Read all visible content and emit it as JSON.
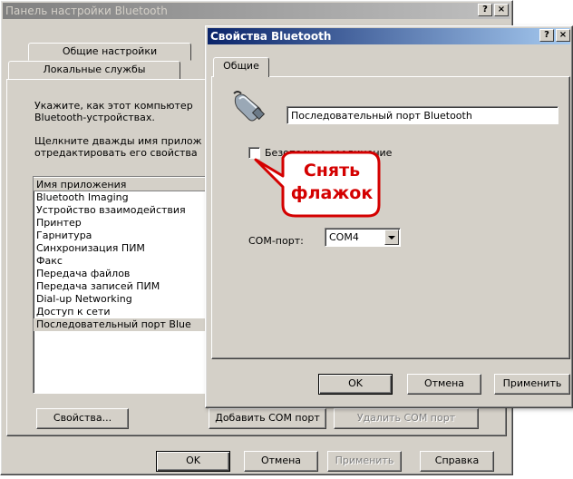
{
  "back_window": {
    "title": "Панель настройки Bluetooth",
    "title_buttons": [
      "?",
      "×"
    ],
    "tabs": [
      {
        "label": "Общие настройки"
      },
      {
        "label": "Локальные службы"
      }
    ],
    "instruction_1": [
      "Укажите, как этот компьютер",
      "Bluetooth-устройствах."
    ],
    "instruction_2": [
      "Щелкните дважды имя прилож",
      "отредактировать его свойства"
    ],
    "list_header": "Имя приложения",
    "list_items": [
      "Bluetooth Imaging",
      "Устройство взаимодействия",
      "Принтер",
      "Гарнитура",
      "Синхронизация ПИМ",
      "Факс",
      "Передача файлов",
      "Передача записей ПИМ",
      "Dial-up Networking",
      "Доступ к сети",
      "Последовательный порт Blue"
    ],
    "selected_item_index": 10,
    "properties_button": "Свойства...",
    "add_com_button": "Добавить COM порт",
    "delete_com_button": "Удалить COM порт",
    "ok_button": "OK",
    "cancel_button": "Отмена",
    "apply_button": "Применить",
    "help_button": "Справка"
  },
  "front_dialog": {
    "title": "Свойства Bluetooth",
    "title_buttons": [
      "?",
      "×"
    ],
    "tab": "Общие",
    "service_name": "Последовательный порт Bluetooth",
    "checkbox_label": "Безопасное соединение",
    "checkbox_checked": false,
    "com_label": "COM-порт:",
    "com_value": "COM4",
    "ok_button": "OK",
    "cancel_button": "Отмена",
    "apply_button": "Применить"
  },
  "annotation": {
    "lines": [
      "Снять",
      "флажок"
    ],
    "color": "#d40000"
  },
  "colors": {
    "face": "#d4d0c8",
    "active_title": "#0a246a",
    "inactive_title": "#808080"
  }
}
